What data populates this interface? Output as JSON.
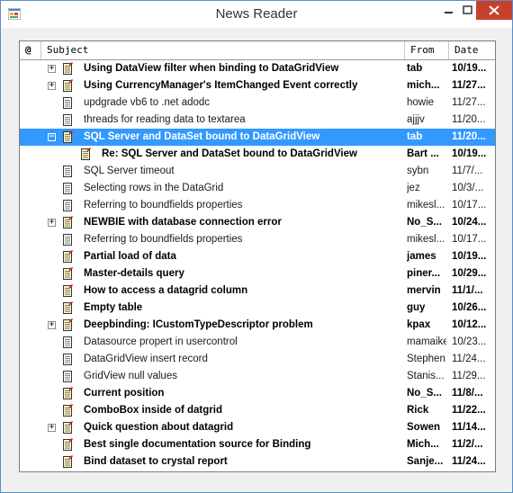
{
  "window": {
    "title": "News Reader",
    "buttons": {
      "minimize": "minimize",
      "maximize": "maximize",
      "close": "close"
    }
  },
  "colors": {
    "selection": "#3399ff",
    "close_button": "#c7402c",
    "border": "#5a8fc7"
  },
  "columns": {
    "attachment": "@",
    "subject": "Subject",
    "from": "From",
    "date": "Date"
  },
  "messages": [
    {
      "subject": "Using DataView filter when binding to DataGridView",
      "from": "tab",
      "date": "10/19...",
      "bold": true,
      "expander": "+",
      "indent": 0,
      "selected": false
    },
    {
      "subject": "Using CurrencyManager's ItemChanged Event correctly",
      "from": "mich...",
      "date": "11/27...",
      "bold": true,
      "expander": "+",
      "indent": 0,
      "selected": false
    },
    {
      "subject": "updgrade vb6 to .net adodc",
      "from": "howie",
      "date": "11/27...",
      "bold": false,
      "expander": "",
      "indent": 0,
      "selected": false
    },
    {
      "subject": "threads for reading data to textarea",
      "from": "ajjjv",
      "date": "11/20...",
      "bold": false,
      "expander": "",
      "indent": 0,
      "selected": false
    },
    {
      "subject": "SQL Server and DataSet bound to DataGridView",
      "from": "tab",
      "date": "11/20...",
      "bold": true,
      "expander": "−",
      "indent": 0,
      "selected": true
    },
    {
      "subject": "Re: SQL Server and DataSet bound to DataGridView",
      "from": "Bart ...",
      "date": "10/19...",
      "bold": true,
      "expander": "",
      "indent": 1,
      "selected": false
    },
    {
      "subject": "SQL Server timeout",
      "from": "sybn",
      "date": "11/7/...",
      "bold": false,
      "expander": "",
      "indent": 0,
      "selected": false
    },
    {
      "subject": "Selecting rows in the DataGrid",
      "from": "jez",
      "date": "10/3/...",
      "bold": false,
      "expander": "",
      "indent": 0,
      "selected": false
    },
    {
      "subject": "Referring to boundfields properties",
      "from": "mikesl...",
      "date": "10/17...",
      "bold": false,
      "expander": "",
      "indent": 0,
      "selected": false
    },
    {
      "subject": "NEWBIE with database connection error",
      "from": "No_S...",
      "date": "10/24...",
      "bold": true,
      "expander": "+",
      "indent": 0,
      "selected": false
    },
    {
      "subject": "Referring to boundfields properties",
      "from": "mikesl...",
      "date": "10/17...",
      "bold": false,
      "expander": "",
      "indent": 0,
      "selected": false
    },
    {
      "subject": "Partial load of data",
      "from": "james",
      "date": "10/19...",
      "bold": true,
      "expander": "",
      "indent": 0,
      "selected": false
    },
    {
      "subject": "Master-details query",
      "from": "piner...",
      "date": "10/29...",
      "bold": true,
      "expander": "",
      "indent": 0,
      "selected": false
    },
    {
      "subject": "How to access a datagrid column",
      "from": "mervin",
      "date": "11/1/...",
      "bold": true,
      "expander": "",
      "indent": 0,
      "selected": false
    },
    {
      "subject": "Empty table",
      "from": "guy",
      "date": "10/26...",
      "bold": true,
      "expander": "",
      "indent": 0,
      "selected": false
    },
    {
      "subject": "Deepbinding: ICustomTypeDescriptor problem",
      "from": "kpax",
      "date": "10/12...",
      "bold": true,
      "expander": "+",
      "indent": 0,
      "selected": false
    },
    {
      "subject": "Datasource propert in usercontrol",
      "from": "mamaike",
      "date": "10/23...",
      "bold": false,
      "expander": "",
      "indent": 0,
      "selected": false
    },
    {
      "subject": "DataGridView insert record",
      "from": "Stephen",
      "date": "11/24...",
      "bold": false,
      "expander": "",
      "indent": 0,
      "selected": false
    },
    {
      "subject": "GridView null values",
      "from": "Stanis...",
      "date": "11/29...",
      "bold": false,
      "expander": "",
      "indent": 0,
      "selected": false
    },
    {
      "subject": "Current position",
      "from": "No_S...",
      "date": "11/8/...",
      "bold": true,
      "expander": "",
      "indent": 0,
      "selected": false
    },
    {
      "subject": "ComboBox inside of datgrid",
      "from": "Rick",
      "date": "11/22...",
      "bold": true,
      "expander": "",
      "indent": 0,
      "selected": false
    },
    {
      "subject": "Quick question about datagrid",
      "from": "Sowen",
      "date": "11/14...",
      "bold": true,
      "expander": "+",
      "indent": 0,
      "selected": false
    },
    {
      "subject": "Best single documentation source for Binding",
      "from": "Mich...",
      "date": "11/2/...",
      "bold": true,
      "expander": "",
      "indent": 0,
      "selected": false
    },
    {
      "subject": "Bind dataset to crystal report",
      "from": "Sanje...",
      "date": "11/24...",
      "bold": true,
      "expander": "",
      "indent": 0,
      "selected": false
    }
  ]
}
